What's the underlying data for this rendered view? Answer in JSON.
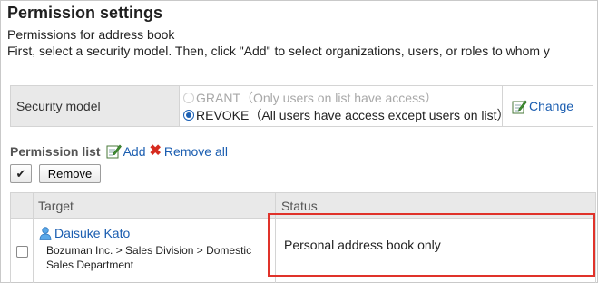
{
  "page": {
    "title": "Permission settings",
    "subtitle": "Permissions for address book",
    "instruction": "First, select a security model. Then, click \"Add\" to select organizations, users, or roles to whom y"
  },
  "security_model": {
    "label": "Security model",
    "options": [
      {
        "label": "GRANT",
        "description": "（Only users on list have access）",
        "selected": false,
        "enabled": false
      },
      {
        "label": "REVOKE",
        "description": "（All users have access except users on list）",
        "selected": true,
        "enabled": true
      }
    ],
    "change_label": "Change"
  },
  "permission_list": {
    "title": "Permission list",
    "add_label": "Add",
    "remove_all_label": "Remove all",
    "check_all_label": "✔",
    "remove_button_label": "Remove"
  },
  "table": {
    "columns": [
      "Target",
      "Status"
    ],
    "rows": [
      {
        "name": "Daisuke Kato",
        "org_path": "Bozuman Inc. > Sales Division > Domestic Sales Department",
        "status": "Personal address book only",
        "checked": false
      }
    ]
  },
  "colors": {
    "link": "#1a5db0",
    "highlight_border": "#e0322a",
    "header_bg": "#e9e9e9",
    "remove_icon": "#d62b1f"
  },
  "icons": [
    "pencil-icon",
    "x-icon",
    "user-icon",
    "checkmark-icon"
  ]
}
